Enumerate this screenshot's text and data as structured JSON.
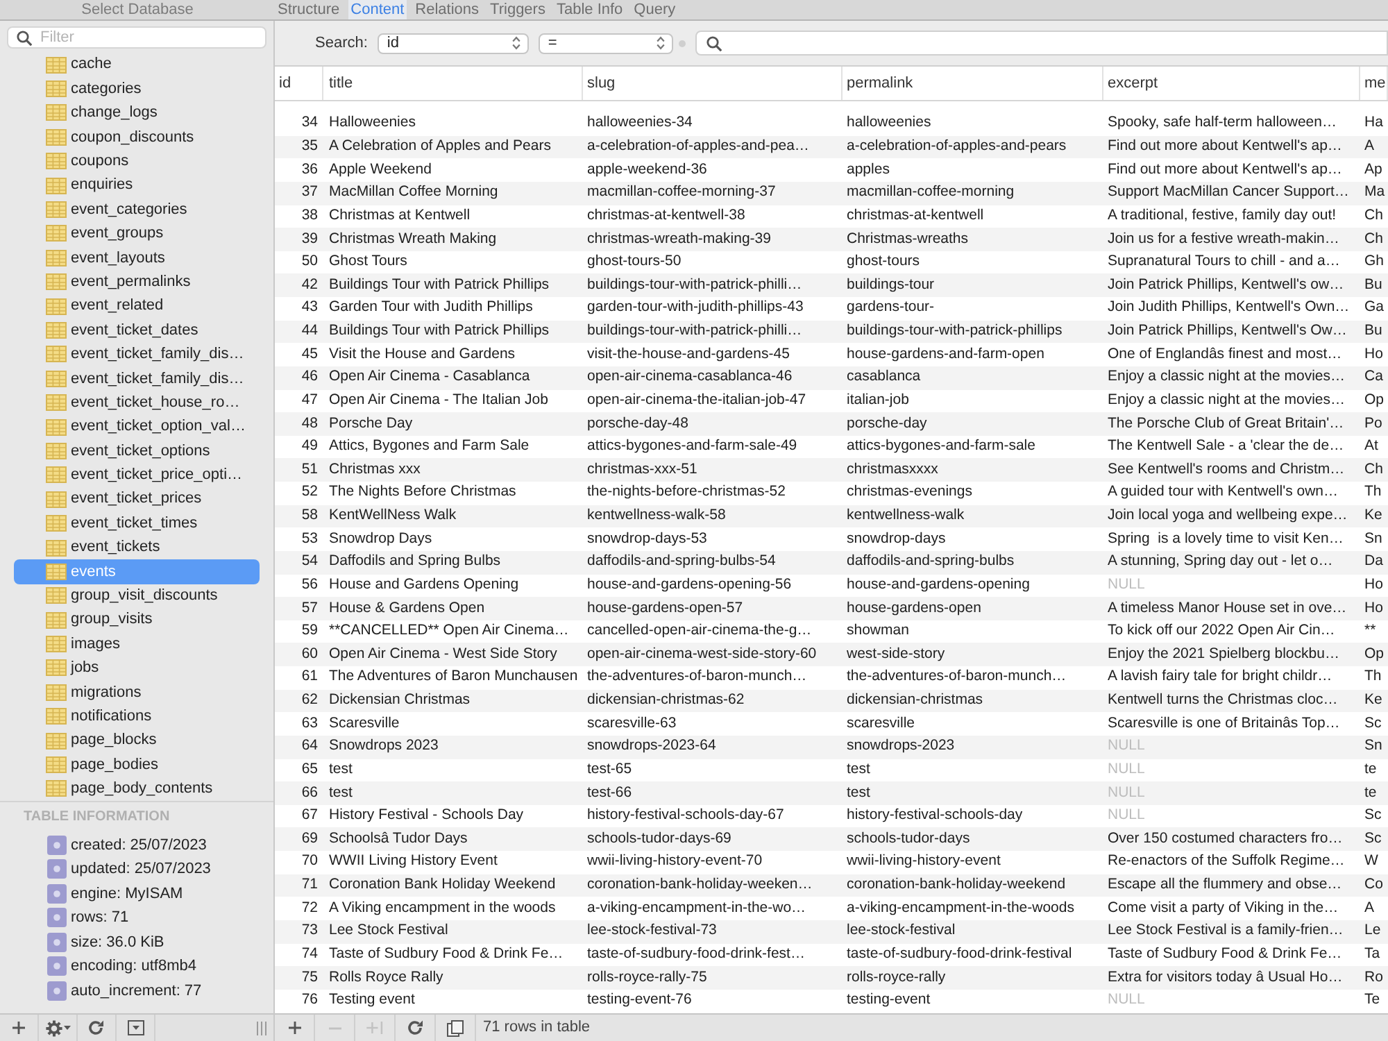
{
  "top_bar": {
    "title": "Select Database",
    "tabs": [
      {
        "label": "Structure",
        "selected": false
      },
      {
        "label": "Content",
        "selected": true
      },
      {
        "label": "Relations",
        "selected": false
      },
      {
        "label": "Triggers",
        "selected": false
      },
      {
        "label": "Table Info",
        "selected": false
      },
      {
        "label": "Query",
        "selected": false
      }
    ]
  },
  "sidebar": {
    "filter": {
      "placeholder": "Filter"
    },
    "tables": [
      {
        "name": "cache",
        "selected": false
      },
      {
        "name": "categories",
        "selected": false
      },
      {
        "name": "change_logs",
        "selected": false
      },
      {
        "name": "coupon_discounts",
        "selected": false
      },
      {
        "name": "coupons",
        "selected": false
      },
      {
        "name": "enquiries",
        "selected": false
      },
      {
        "name": "event_categories",
        "selected": false
      },
      {
        "name": "event_groups",
        "selected": false
      },
      {
        "name": "event_layouts",
        "selected": false
      },
      {
        "name": "event_permalinks",
        "selected": false
      },
      {
        "name": "event_related",
        "selected": false
      },
      {
        "name": "event_ticket_dates",
        "selected": false
      },
      {
        "name": "event_ticket_family_dis…",
        "selected": false
      },
      {
        "name": "event_ticket_family_dis…",
        "selected": false
      },
      {
        "name": "event_ticket_house_ro…",
        "selected": false
      },
      {
        "name": "event_ticket_option_val…",
        "selected": false
      },
      {
        "name": "event_ticket_options",
        "selected": false
      },
      {
        "name": "event_ticket_price_opti…",
        "selected": false
      },
      {
        "name": "event_ticket_prices",
        "selected": false
      },
      {
        "name": "event_ticket_times",
        "selected": false
      },
      {
        "name": "event_tickets",
        "selected": false
      },
      {
        "name": "events",
        "selected": true
      },
      {
        "name": "group_visit_discounts",
        "selected": false
      },
      {
        "name": "group_visits",
        "selected": false
      },
      {
        "name": "images",
        "selected": false
      },
      {
        "name": "jobs",
        "selected": false
      },
      {
        "name": "migrations",
        "selected": false
      },
      {
        "name": "notifications",
        "selected": false
      },
      {
        "name": "page_blocks",
        "selected": false
      },
      {
        "name": "page_bodies",
        "selected": false
      },
      {
        "name": "page_body_contents",
        "selected": false
      }
    ],
    "table_information": {
      "heading": "TABLE INFORMATION",
      "items": [
        "created: 25/07/2023",
        "updated: 25/07/2023",
        "engine: MyISAM",
        "rows: 71",
        "size: 36.0 KiB",
        "encoding: utf8mb4",
        "auto_increment: 77"
      ]
    },
    "toolbar": [
      {
        "kind": "add"
      },
      {
        "kind": "settings"
      },
      {
        "kind": "refresh"
      },
      {
        "kind": "toggle"
      }
    ]
  },
  "search": {
    "label": "Search:",
    "field": "id",
    "operator": "="
  },
  "table": {
    "columns": [
      "id",
      "title",
      "slug",
      "permalink",
      "excerpt",
      "me"
    ],
    "rows": [
      {
        "cells": [
          "34",
          "Halloweenies",
          "halloweenies-34",
          "halloweenies",
          "Spooky, safe half-term halloween…",
          "Ha"
        ],
        "excerpt_null": false
      },
      {
        "cells": [
          "35",
          "A Celebration of Apples and Pears",
          "a-celebration-of-apples-and-pea…",
          "a-celebration-of-apples-and-pears",
          "Find out more about Kentwell's ap…",
          "A"
        ],
        "excerpt_null": false
      },
      {
        "cells": [
          "36",
          "Apple Weekend",
          "apple-weekend-36",
          "apples",
          "Find out more about Kentwell's ap…",
          "Ap"
        ],
        "excerpt_null": false
      },
      {
        "cells": [
          "37",
          "MacMillan Coffee Morning",
          "macmillan-coffee-morning-37",
          "macmillan-coffee-morning",
          "Support MacMillan Cancer Support…",
          "Ma"
        ],
        "excerpt_null": false
      },
      {
        "cells": [
          "38",
          "Christmas at Kentwell",
          "christmas-at-kentwell-38",
          "christmas-at-kentwell",
          "A traditional, festive, family day out!",
          "Ch"
        ],
        "excerpt_null": false
      },
      {
        "cells": [
          "39",
          "Christmas Wreath Making",
          "christmas-wreath-making-39",
          "Christmas-wreaths",
          "Join us for a festive wreath-makin…",
          "Ch"
        ],
        "excerpt_null": false
      },
      {
        "cells": [
          "50",
          "Ghost Tours",
          "ghost-tours-50",
          "ghost-tours",
          "Supranatural Tours to chill - and a…",
          "Gh"
        ],
        "excerpt_null": false
      },
      {
        "cells": [
          "42",
          "Buildings Tour with Patrick Phillips",
          "buildings-tour-with-patrick-philli…",
          "buildings-tour",
          "Join Patrick Phillips, Kentwell's ow…",
          "Bu"
        ],
        "excerpt_null": false
      },
      {
        "cells": [
          "43",
          "Garden Tour with Judith Phillips",
          "garden-tour-with-judith-phillips-43",
          "gardens-tour-",
          "Join Judith Phillips, Kentwell's Own…",
          "Ga"
        ],
        "excerpt_null": false
      },
      {
        "cells": [
          "44",
          "Buildings Tour with Patrick Phillips",
          "buildings-tour-with-patrick-philli…",
          "buildings-tour-with-patrick-phillips",
          "Join Patrick Phillips, Kentwell's Ow…",
          "Bu"
        ],
        "excerpt_null": false
      },
      {
        "cells": [
          "45",
          "Visit the House and Gardens",
          "visit-the-house-and-gardens-45",
          "house-gardens-and-farm-open",
          "One of Englandâs finest and most…",
          "Ho"
        ],
        "excerpt_null": false
      },
      {
        "cells": [
          "46",
          "Open Air Cinema - Casablanca",
          "open-air-cinema-casablanca-46",
          "casablanca",
          "Enjoy a classic night at the movies…",
          "Ca"
        ],
        "excerpt_null": false
      },
      {
        "cells": [
          "47",
          "Open Air Cinema - The Italian Job",
          "open-air-cinema-the-italian-job-47",
          "italian-job",
          "Enjoy a classic night at the movies…",
          "Op"
        ],
        "excerpt_null": false
      },
      {
        "cells": [
          "48",
          "Porsche Day",
          "porsche-day-48",
          "porsche-day",
          "The Porsche Club of Great Britain'…",
          "Po"
        ],
        "excerpt_null": false
      },
      {
        "cells": [
          "49",
          "Attics, Bygones and Farm Sale",
          "attics-bygones-and-farm-sale-49",
          "attics-bygones-and-farm-sale",
          "The Kentwell Sale - a 'clear the de…",
          "At"
        ],
        "excerpt_null": false
      },
      {
        "cells": [
          "51",
          "Christmas xxx",
          "christmas-xxx-51",
          "christmasxxxx",
          "See Kentwell's rooms and Christm…",
          "Ch"
        ],
        "excerpt_null": false
      },
      {
        "cells": [
          "52",
          "The Nights Before Christmas",
          "the-nights-before-christmas-52",
          "christmas-evenings",
          "A guided tour with Kentwell's own…",
          "Th"
        ],
        "excerpt_null": false
      },
      {
        "cells": [
          "58",
          "KentWellNess Walk",
          "kentwellness-walk-58",
          "kentwellness-walk",
          "Join local yoga and wellbeing expe…",
          "Ke"
        ],
        "excerpt_null": false
      },
      {
        "cells": [
          "53",
          "Snowdrop Days",
          "snowdrop-days-53",
          "snowdrop-days",
          "Spring  is a lovely time to visit Ken…",
          "Sn"
        ],
        "excerpt_null": false
      },
      {
        "cells": [
          "54",
          "Daffodils and Spring Bulbs",
          "daffodils-and-spring-bulbs-54",
          "daffodils-and-spring-bulbs",
          "A stunning, Spring day out - let o…",
          "Da"
        ],
        "excerpt_null": false
      },
      {
        "cells": [
          "56",
          "House and Gardens Opening",
          "house-and-gardens-opening-56",
          "house-and-gardens-opening",
          "NULL",
          "Ho"
        ],
        "excerpt_null": true
      },
      {
        "cells": [
          "57",
          "House & Gardens Open",
          "house-gardens-open-57",
          "house-gardens-open",
          "A timeless Manor House set in ove…",
          "Ho"
        ],
        "excerpt_null": false
      },
      {
        "cells": [
          "59",
          "**CANCELLED** Open Air Cinema…",
          "cancelled-open-air-cinema-the-g…",
          "showman",
          "To kick off our 2022 Open Air Cin…",
          "**"
        ],
        "excerpt_null": false
      },
      {
        "cells": [
          "60",
          "Open Air Cinema - West Side Story",
          "open-air-cinema-west-side-story-60",
          "west-side-story",
          "Enjoy the 2021 Spielberg blockbu…",
          "Op"
        ],
        "excerpt_null": false
      },
      {
        "cells": [
          "61",
          "The Adventures of Baron Munchausen",
          "the-adventures-of-baron-munch…",
          "the-adventures-of-baron-munch…",
          "A lavish fairy tale for bright childr…",
          "Th"
        ],
        "excerpt_null": false
      },
      {
        "cells": [
          "62",
          "Dickensian Christmas",
          "dickensian-christmas-62",
          "dickensian-christmas",
          "Kentwell turns the Christmas cloc…",
          "Ke"
        ],
        "excerpt_null": false
      },
      {
        "cells": [
          "63",
          "Scaresville",
          "scaresville-63",
          "scaresville",
          "Scaresville is one of Britainâs Top…",
          "Sc"
        ],
        "excerpt_null": false
      },
      {
        "cells": [
          "64",
          "Snowdrops 2023",
          "snowdrops-2023-64",
          "snowdrops-2023",
          "NULL",
          "Sn"
        ],
        "excerpt_null": true
      },
      {
        "cells": [
          "65",
          "test",
          "test-65",
          "test",
          "NULL",
          "te"
        ],
        "excerpt_null": true
      },
      {
        "cells": [
          "66",
          "test",
          "test-66",
          "test",
          "NULL",
          "te"
        ],
        "excerpt_null": true
      },
      {
        "cells": [
          "67",
          "History Festival - Schools Day",
          "history-festival-schools-day-67",
          "history-festival-schools-day",
          "NULL",
          "Sc"
        ],
        "excerpt_null": true
      },
      {
        "cells": [
          "69",
          "Schoolsâ Tudor Days",
          "schools-tudor-days-69",
          "schools-tudor-days",
          "Over 150 costumed characters fro…",
          "Sc"
        ],
        "excerpt_null": false
      },
      {
        "cells": [
          "70",
          "WWII Living History Event",
          "wwii-living-history-event-70",
          "wwii-living-history-event",
          "Re-enactors of the Suffolk Regime…",
          "W"
        ],
        "excerpt_null": false
      },
      {
        "cells": [
          "71",
          "Coronation Bank Holiday Weekend",
          "coronation-bank-holiday-weeken…",
          "coronation-bank-holiday-weekend",
          "Escape all the flummery and obse…",
          "Co"
        ],
        "excerpt_null": false
      },
      {
        "cells": [
          "72",
          "A Viking encampment in the woods",
          "a-viking-encampment-in-the-wo…",
          "a-viking-encampment-in-the-woods",
          "Come visit a party of Viking in the…",
          "A"
        ],
        "excerpt_null": false
      },
      {
        "cells": [
          "73",
          "Lee Stock Festival",
          "lee-stock-festival-73",
          "lee-stock-festival",
          "Lee Stock Festival is a family-frien…",
          "Le"
        ],
        "excerpt_null": false
      },
      {
        "cells": [
          "74",
          "Taste of Sudbury Food & Drink Fe…",
          "taste-of-sudbury-food-drink-fest…",
          "taste-of-sudbury-food-drink-festival",
          "Taste of Sudbury Food & Drink Fe…",
          "Ta"
        ],
        "excerpt_null": false
      },
      {
        "cells": [
          "75",
          "Rolls Royce Rally",
          "rolls-royce-rally-75",
          "rolls-royce-rally",
          "Extra for visitors today â Usual Ho…",
          "Ro"
        ],
        "excerpt_null": false
      },
      {
        "cells": [
          "76",
          "Testing event",
          "testing-event-76",
          "testing-event",
          "NULL",
          "Te"
        ],
        "excerpt_null": true
      }
    ]
  },
  "bottom_bar": {
    "buttons": [
      {
        "kind": "add",
        "disabled": false
      },
      {
        "kind": "remove",
        "disabled": true
      },
      {
        "kind": "duplicate",
        "disabled": true
      },
      {
        "kind": "refresh",
        "disabled": false
      },
      {
        "kind": "copy",
        "disabled": false
      }
    ],
    "status": "71 rows in table"
  }
}
